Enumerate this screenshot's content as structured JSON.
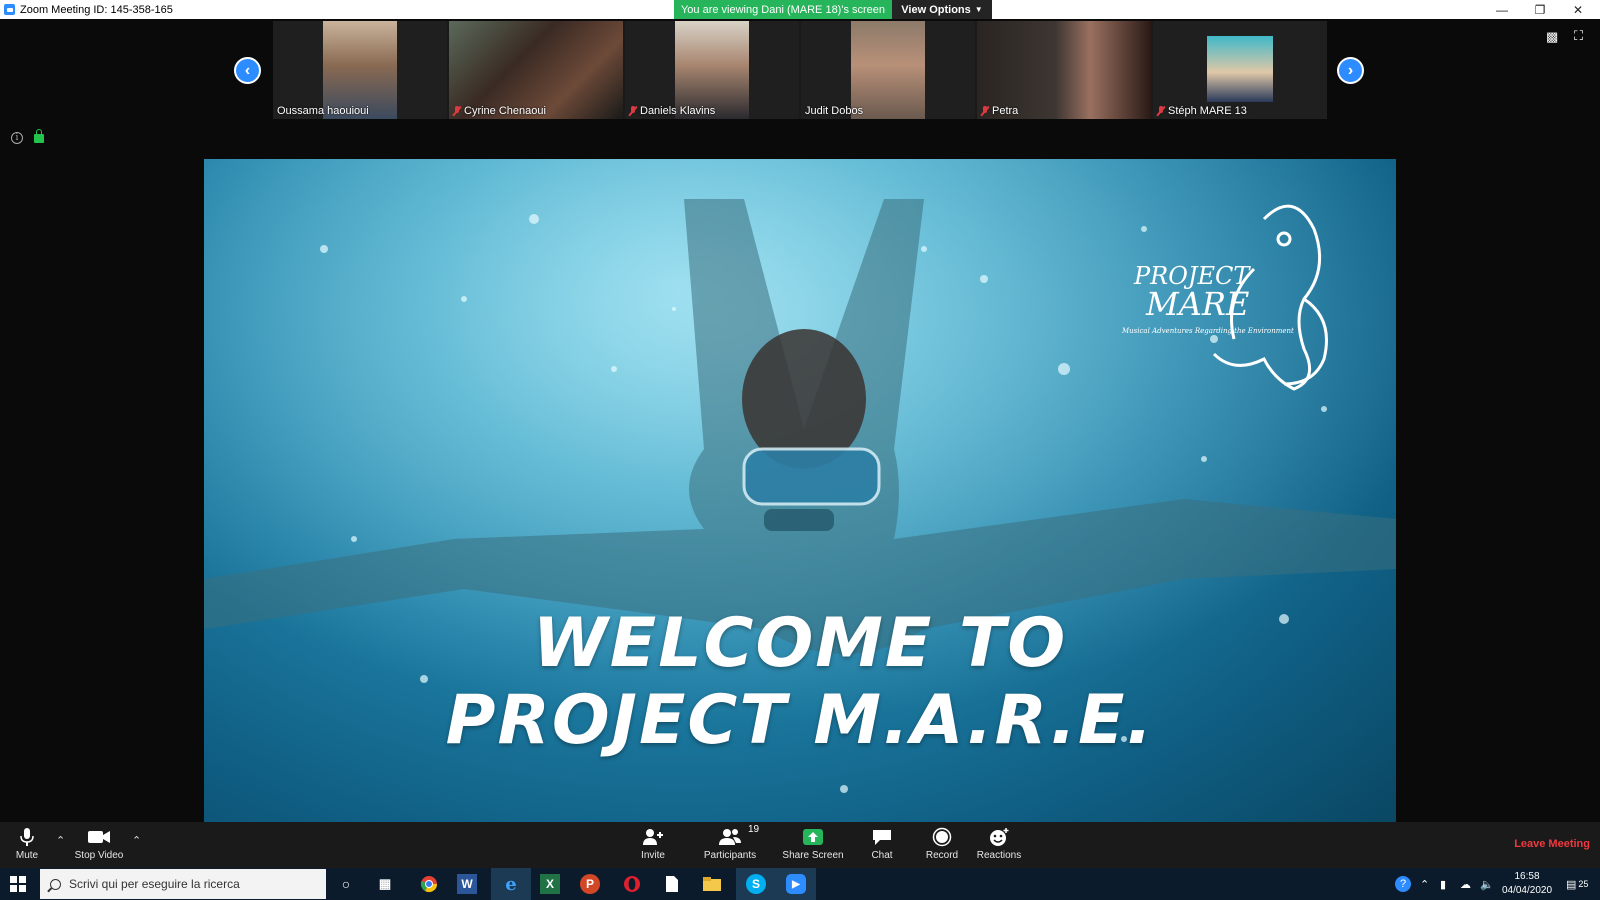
{
  "window": {
    "title": "Zoom Meeting ID: 145-358-165",
    "viewing_banner": "You are viewing Dani (MARE 18)'s screen",
    "view_options": "View Options"
  },
  "participants": [
    {
      "name": "Oussama haouioui",
      "muted": false
    },
    {
      "name": "Cyrine Chenaoui",
      "muted": true
    },
    {
      "name": "Daniels Klavins",
      "muted": true
    },
    {
      "name": "Judit Dobos",
      "muted": false
    },
    {
      "name": "Petra",
      "muted": true
    },
    {
      "name": "Stéph MARE 13",
      "muted": true
    }
  ],
  "shared_screen": {
    "headline_line1": "WELCOME TO",
    "headline_line2": "PROJECT M.A.R.E.",
    "logo_line1": "PROJECT",
    "logo_line2": "MARE",
    "logo_tagline": "Musical Adventures Regarding the Environment"
  },
  "toolbar": {
    "mute": "Mute",
    "stop_video": "Stop Video",
    "invite": "Invite",
    "participants": "Participants",
    "participant_count": "19",
    "share_screen": "Share Screen",
    "chat": "Chat",
    "record": "Record",
    "reactions": "Reactions",
    "leave": "Leave Meeting"
  },
  "taskbar": {
    "search_placeholder": "Scrivi qui per eseguire la ricerca",
    "time": "16:58",
    "date": "04/04/2020",
    "notifications": "25"
  },
  "colors": {
    "zoom_blue": "#2d8cff",
    "banner_green": "#26b55a",
    "leave_red": "#f0393f",
    "muted_red": "#e0393e"
  }
}
